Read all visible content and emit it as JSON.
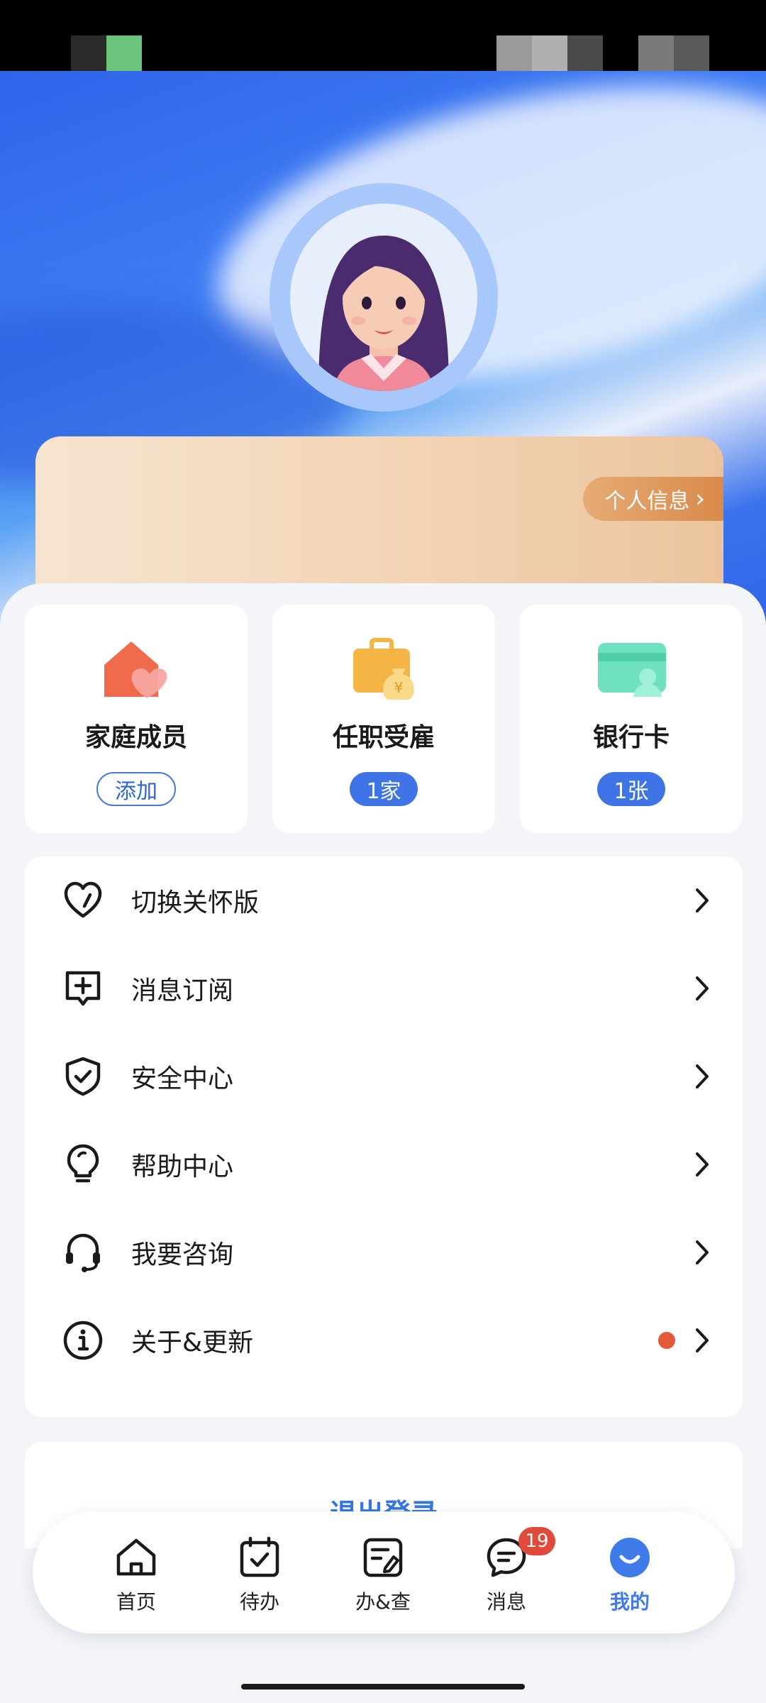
{
  "profile": {
    "personal_info_label": "个人信息"
  },
  "tiles": [
    {
      "title": "家庭成员",
      "badge": "添加",
      "icon": "family-house-heart-icon"
    },
    {
      "title": "任职受雇",
      "badge": "1家",
      "icon": "briefcase-money-icon"
    },
    {
      "title": "银行卡",
      "badge": "1张",
      "icon": "bank-card-icon"
    }
  ],
  "menu": [
    {
      "label": "切换关怀版",
      "icon": "heart-icon"
    },
    {
      "label": "消息订阅",
      "icon": "message-plus-icon"
    },
    {
      "label": "安全中心",
      "icon": "shield-check-icon"
    },
    {
      "label": "帮助中心",
      "icon": "lightbulb-icon"
    },
    {
      "label": "我要咨询",
      "icon": "headset-icon"
    },
    {
      "label": "关于&更新",
      "icon": "info-icon",
      "has_update_dot": true
    }
  ],
  "logout": {
    "label": "退出登录"
  },
  "tabbar": {
    "tabs": [
      {
        "label": "首页",
        "icon": "home-icon"
      },
      {
        "label": "待办",
        "icon": "calendar-check-icon"
      },
      {
        "label": "办&查",
        "icon": "document-edit-icon"
      },
      {
        "label": "消息",
        "icon": "chat-icon",
        "badge": "19"
      },
      {
        "label": "我的",
        "icon": "smile-user-icon",
        "active": true
      }
    ]
  },
  "colors": {
    "accent": "#3e74e6",
    "badge_red": "#e04a3a",
    "hero_blue": "#2f64ea"
  }
}
